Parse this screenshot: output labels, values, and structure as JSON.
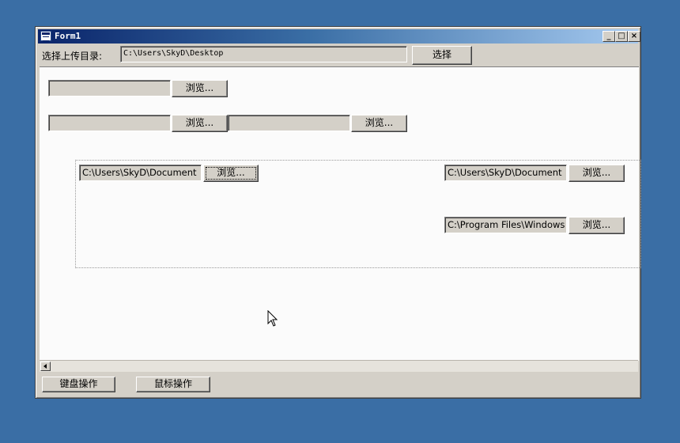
{
  "window": {
    "title": "Form1"
  },
  "window_controls": {
    "minimize": "_",
    "maximize": "□",
    "close": "×"
  },
  "upload": {
    "label": "选择上传目录:",
    "path": "C:\\Users\\SkyD\\Desktop",
    "choose_label": "选择"
  },
  "rows": {
    "row1": {
      "value": "",
      "browse_label": "浏览..."
    },
    "row2a": {
      "value": "",
      "browse_label": "浏览..."
    },
    "row2b": {
      "value": "",
      "browse_label": "浏览..."
    }
  },
  "group": {
    "left": {
      "value": "C:\\Users\\SkyD\\Document",
      "browse_label": "浏览..."
    },
    "right_top": {
      "value": "C:\\Users\\SkyD\\Document",
      "browse_label": "浏览..."
    },
    "right_bottom": {
      "value": "C:\\Program Files\\Windows",
      "browse_label": "浏览..."
    }
  },
  "bottom": {
    "keyboard_label": "键盘操作",
    "mouse_label": "鼠标操作"
  },
  "colors": {
    "desktop": "#3a6ea5",
    "title_start": "#0a246a",
    "title_end": "#a6caf0",
    "face": "#d4d0c8"
  },
  "icons": [
    "form-icon",
    "minimize-icon",
    "maximize-icon",
    "close-icon",
    "scroll-left-icon",
    "mouse-cursor-icon"
  ]
}
